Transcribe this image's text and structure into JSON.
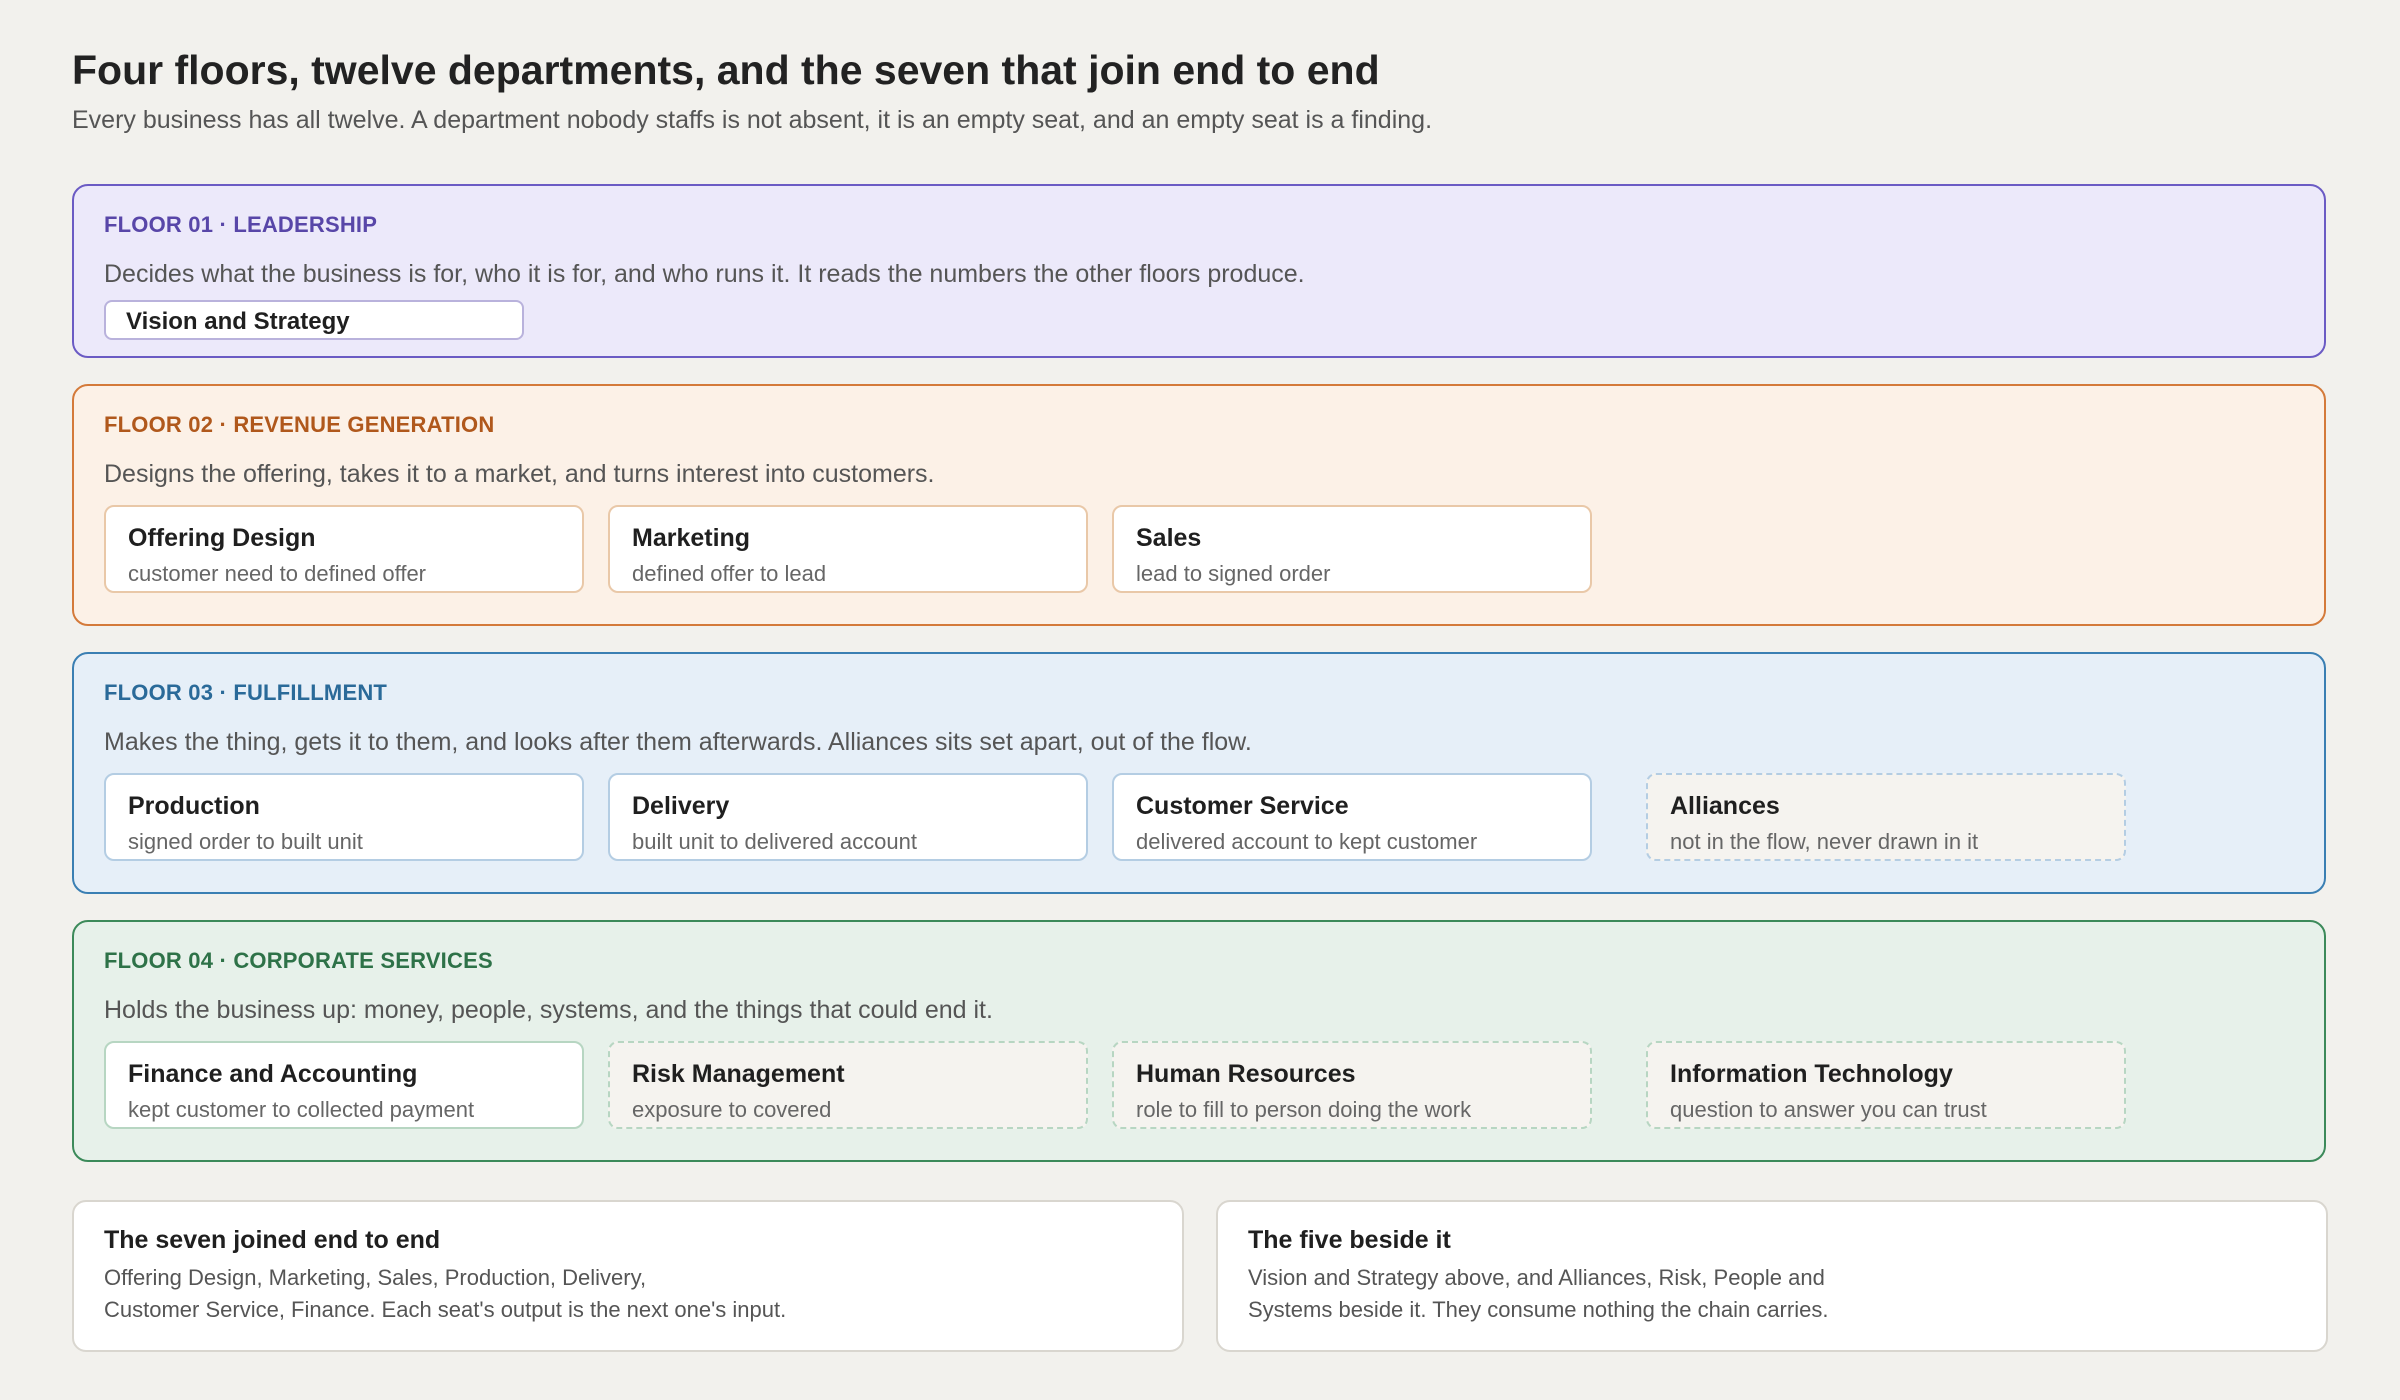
{
  "title": "Four floors, twelve departments, and the seven that join end to end",
  "subtitle": "Every business has all twelve. A department nobody staffs is not absent, it is an empty seat, and an empty seat is a finding.",
  "floors": [
    {
      "label": "FLOOR 01 · LEADERSHIP",
      "description": "Decides what the business is for, who it is for, and who runs it. It reads the numbers the other floors produce.",
      "departments": [
        {
          "name": "Vision and Strategy"
        }
      ]
    },
    {
      "label": "FLOOR 02 · REVENUE GENERATION",
      "description": "Designs the offering, takes it to a market, and turns interest into customers.",
      "departments": [
        {
          "name": "Offering Design",
          "flow": "customer need to defined offer"
        },
        {
          "name": "Marketing",
          "flow": "defined offer to lead"
        },
        {
          "name": "Sales",
          "flow": "lead to signed order"
        }
      ]
    },
    {
      "label": "FLOOR 03 · FULFILLMENT",
      "description": "Makes the thing, gets it to them, and looks after them afterwards. Alliances sits set apart, out of the flow.",
      "departments": [
        {
          "name": "Production",
          "flow": "signed order to built unit"
        },
        {
          "name": "Delivery",
          "flow": "built unit to delivered account"
        },
        {
          "name": "Customer Service",
          "flow": "delivered account to kept customer"
        },
        {
          "name": "Alliances",
          "flow": "not in the flow, never drawn in it"
        }
      ]
    },
    {
      "label": "FLOOR 04 · CORPORATE SERVICES",
      "description": "Holds the business up: money, people, systems, and the things that could end it.",
      "departments": [
        {
          "name": "Finance and Accounting",
          "flow": "kept customer to collected payment"
        },
        {
          "name": "Risk Management",
          "flow": "exposure to covered"
        },
        {
          "name": "Human Resources",
          "flow": "role to fill to person doing the work"
        },
        {
          "name": "Information Technology",
          "flow": "question to answer you can trust"
        }
      ]
    }
  ],
  "summaries": [
    {
      "title": "The seven joined end to end",
      "line1": "Offering Design, Marketing, Sales, Production, Delivery,",
      "line2": "Customer Service, Finance. Each seat's output is the next one's input."
    },
    {
      "title": "The five beside it",
      "line1": "Vision and Strategy above, and Alliances, Risk, People and",
      "line2": "Systems beside it. They consume nothing the chain carries."
    }
  ]
}
